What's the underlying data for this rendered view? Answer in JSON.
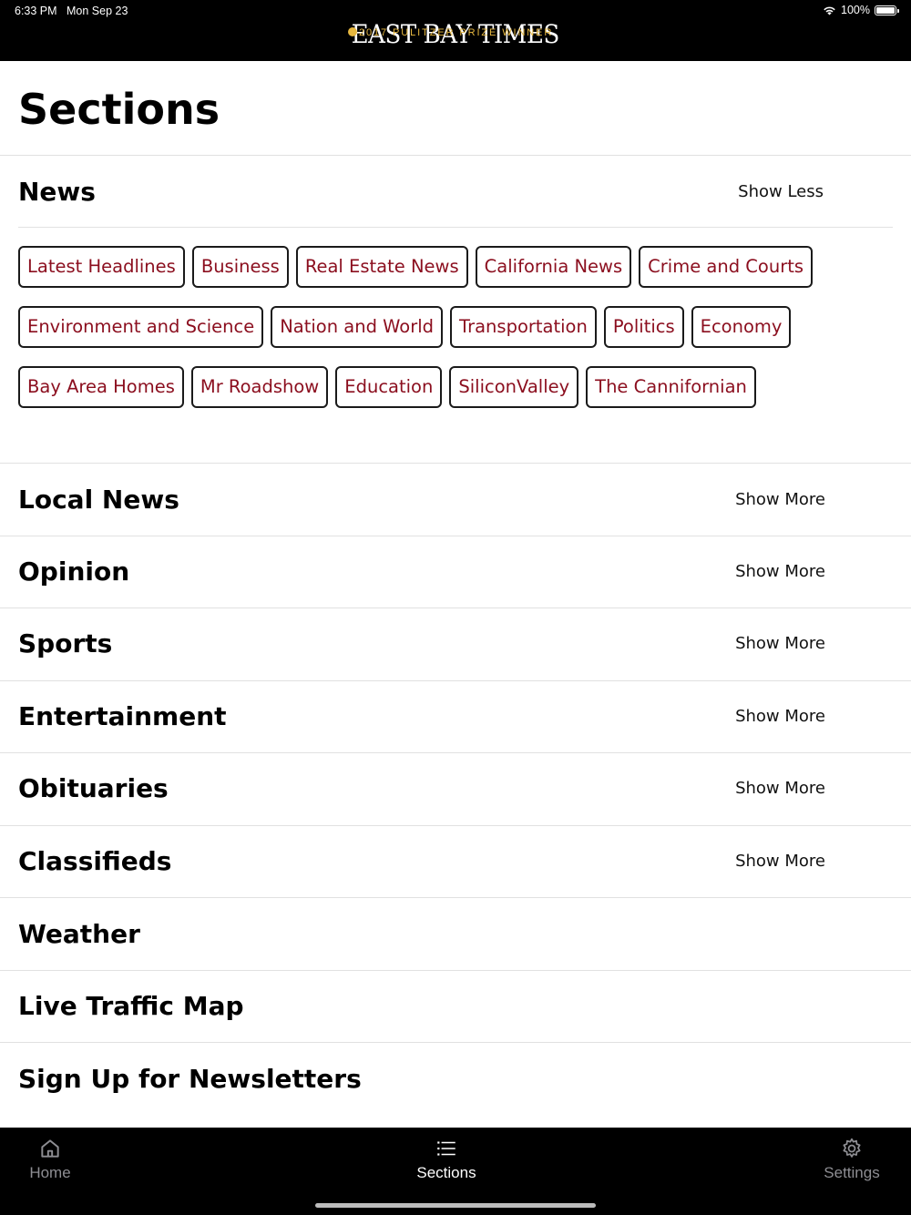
{
  "status": {
    "time": "6:33 PM",
    "date": "Mon Sep 23",
    "battery": "100%"
  },
  "header": {
    "logo_title": "EAST BAY TIMES",
    "logo_subtitle": "2017 PULITZER PRIZE WINNER",
    "accent": "#e6b73f"
  },
  "page": {
    "title": "Sections"
  },
  "sections": [
    {
      "label": "News",
      "toggle": "Show Less",
      "expanded": true,
      "subsections": [
        [
          "Latest Headlines",
          "Business",
          "Real Estate News",
          "California News",
          "Crime and Courts"
        ],
        [
          "Environment and Science",
          "Nation and World",
          "Transportation",
          "Politics",
          "Economy"
        ],
        [
          "Bay Area Homes",
          "Mr Roadshow",
          "Education",
          "SiliconValley",
          "The Cannifornian"
        ]
      ]
    },
    {
      "label": "Local News",
      "toggle": "Show More"
    },
    {
      "label": "Opinion",
      "toggle": "Show More"
    },
    {
      "label": "Sports",
      "toggle": "Show More"
    },
    {
      "label": "Entertainment",
      "toggle": "Show More"
    },
    {
      "label": "Obituaries",
      "toggle": "Show More"
    },
    {
      "label": "Classifieds",
      "toggle": "Show More"
    },
    {
      "label": "Weather",
      "toggle": ""
    },
    {
      "label": "Live Traffic Map",
      "toggle": ""
    },
    {
      "label": "Sign Up for Newsletters",
      "toggle": ""
    }
  ],
  "tabbar": {
    "tabs": [
      {
        "label": "Home",
        "icon": "home-icon",
        "active": false
      },
      {
        "label": "Sections",
        "icon": "list-icon",
        "active": true
      },
      {
        "label": "Settings",
        "icon": "gear-icon",
        "active": false
      }
    ]
  },
  "colors": {
    "chip_text": "#8b0e1e",
    "header_bg": "#000000"
  }
}
